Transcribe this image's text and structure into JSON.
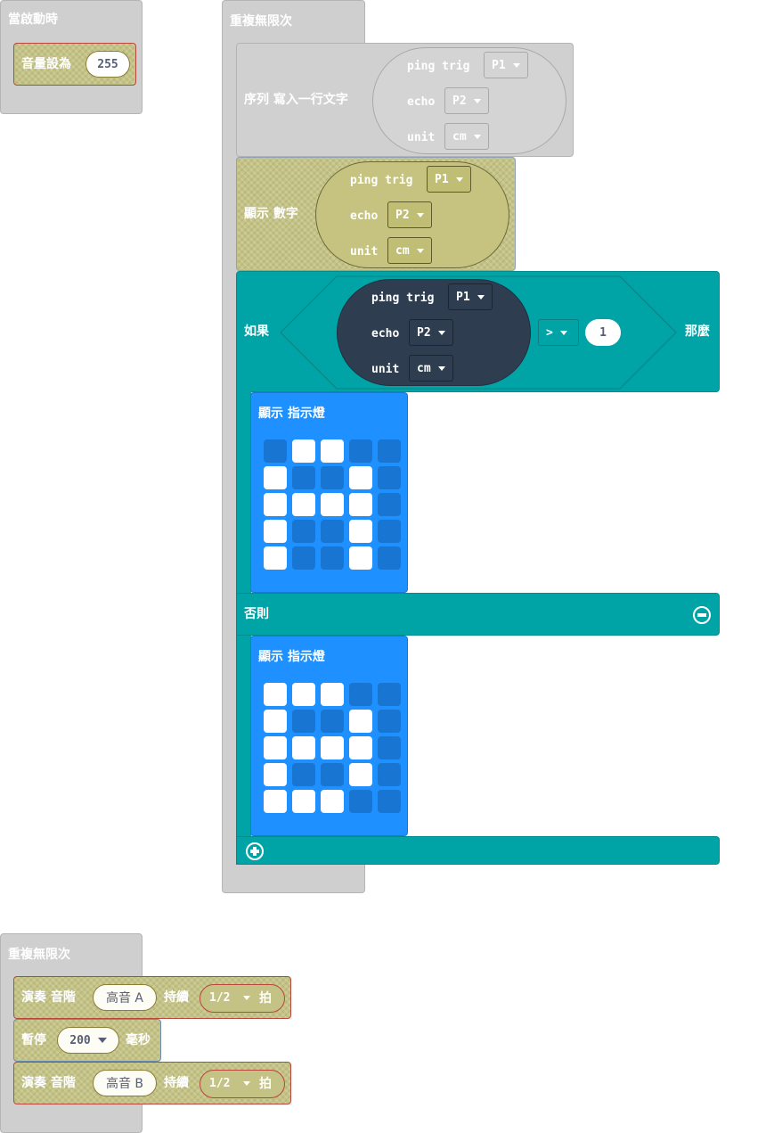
{
  "on_start": {
    "hat_label": "當啟動時",
    "volume_label": "音量設為",
    "volume_value": "255"
  },
  "forever_main": {
    "hat_label": "重複無限次",
    "serial": {
      "label": "序列 寫入一行文字",
      "ping_trig_label": "ping trig",
      "trig_pin": "P1",
      "echo_label": "echo",
      "echo_pin": "P2",
      "unit_label": "unit",
      "unit": "cm"
    },
    "show_number": {
      "label": "顯示 數字",
      "ping_trig_label": "ping trig",
      "trig_pin": "P1",
      "echo_label": "echo",
      "echo_pin": "P2",
      "unit_label": "unit",
      "unit": "cm"
    },
    "if_block": {
      "if_label": "如果",
      "then_label": "那麼",
      "else_label": "否則",
      "ping_trig_label": "ping trig",
      "trig_pin": "P1",
      "echo_label": "echo",
      "echo_pin": "P2",
      "unit_label": "unit",
      "unit": "cm",
      "operator": ">",
      "compare_value": "1",
      "show_leds_then": {
        "label": "顯示 指示燈",
        "leds": [
          [
            0,
            1,
            1,
            0,
            0
          ],
          [
            1,
            0,
            0,
            1,
            0
          ],
          [
            1,
            1,
            1,
            1,
            0
          ],
          [
            1,
            0,
            0,
            1,
            0
          ],
          [
            1,
            0,
            0,
            1,
            0
          ]
        ]
      },
      "show_leds_else": {
        "label": "顯示 指示燈",
        "leds": [
          [
            1,
            1,
            1,
            0,
            0
          ],
          [
            1,
            0,
            0,
            1,
            0
          ],
          [
            1,
            1,
            1,
            1,
            0
          ],
          [
            1,
            0,
            0,
            1,
            0
          ],
          [
            1,
            1,
            1,
            0,
            0
          ]
        ]
      }
    }
  },
  "forever_music": {
    "hat_label": "重複無限次",
    "play1": {
      "play_label": "演奏 音階",
      "note": "高音 A",
      "duration_label": "持續",
      "beat": "1/2",
      "beat_unit": "拍"
    },
    "pause": {
      "label": "暫停",
      "value": "200",
      "unit": "毫秒"
    },
    "play2": {
      "play_label": "演奏 音階",
      "note": "高音 B",
      "duration_label": "持續",
      "beat": "1/2",
      "beat_unit": "拍"
    }
  }
}
